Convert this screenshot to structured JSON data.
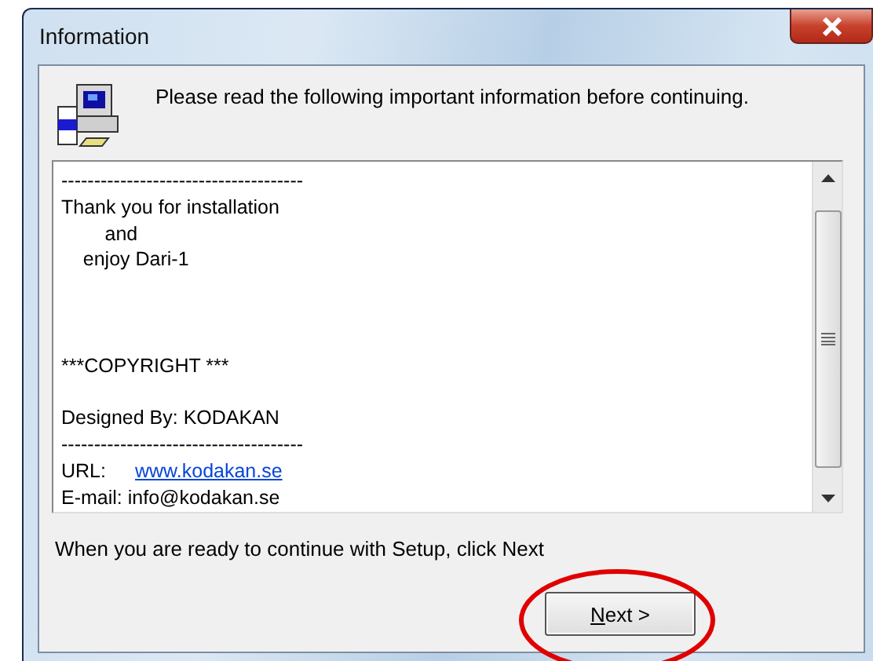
{
  "window": {
    "title": "Information"
  },
  "header": {
    "text": "Please read the following important information before continuing."
  },
  "memo": {
    "lines": [
      {
        "kind": "text",
        "text": "-------------------------------------"
      },
      {
        "kind": "text",
        "text": "Thank you for installation"
      },
      {
        "kind": "text",
        "text": "        and"
      },
      {
        "kind": "text",
        "text": "    enjoy Dari-1"
      },
      {
        "kind": "blank"
      },
      {
        "kind": "blank"
      },
      {
        "kind": "blank"
      },
      {
        "kind": "text",
        "text": "***COPYRIGHT ***"
      },
      {
        "kind": "blank"
      },
      {
        "kind": "text",
        "text": "Designed By: KODAKAN"
      },
      {
        "kind": "text",
        "text": "-------------------------------------"
      },
      {
        "kind": "link",
        "label": "URL:",
        "link": "www.kodakan.se"
      },
      {
        "kind": "text",
        "text": "E-mail: info@kodakan.se"
      }
    ]
  },
  "footer": {
    "text": "When you are ready to continue with Setup, click Next"
  },
  "buttons": [
    {
      "label_parts": [
        {
          "text": "N",
          "underlined": true
        },
        {
          "text": "ext >",
          "underlined": false
        }
      ],
      "highlighted": true
    }
  ]
}
